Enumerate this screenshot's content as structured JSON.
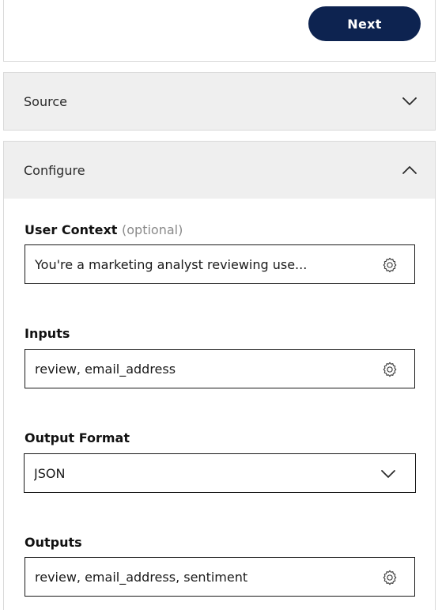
{
  "toolbar": {
    "next_label": "Next"
  },
  "panels": {
    "source": {
      "title": "Source",
      "expanded": false
    },
    "configure": {
      "title": "Configure",
      "expanded": true
    }
  },
  "configure": {
    "user_context": {
      "label": "User Context",
      "optional_hint": "(optional)",
      "value": "You're a marketing analyst reviewing use..."
    },
    "inputs": {
      "label": "Inputs",
      "value": "review, email_address"
    },
    "output_format": {
      "label": "Output Format",
      "selected": "JSON"
    },
    "outputs": {
      "label": "Outputs",
      "value": "review, email_address, sentiment"
    }
  },
  "colors": {
    "primary_button": "#0d2350",
    "panel_header_bg": "#efefef",
    "border": "#d9d9d9",
    "optional_text": "#8a8a8a"
  },
  "icons": {
    "settings": "gear-icon",
    "collapsed": "chevron-down-icon",
    "expanded": "chevron-up-icon"
  }
}
